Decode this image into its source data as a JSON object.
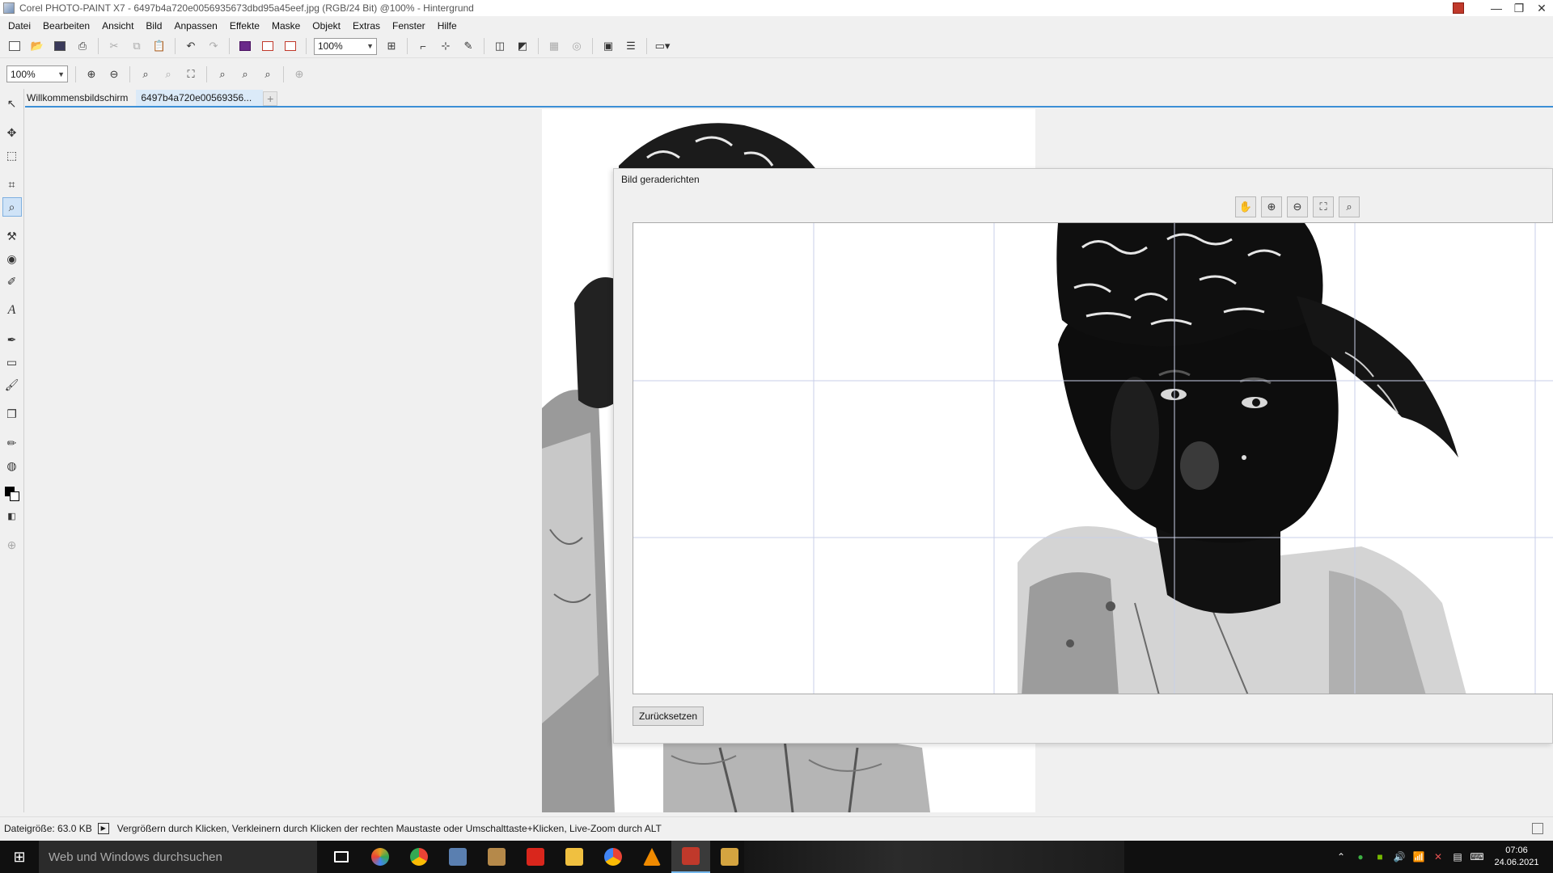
{
  "window": {
    "title": "Corel PHOTO-PAINT X7 - 6497b4a720e0056935673dbd95a45eef.jpg (RGB/24 Bit) @100% - Hintergrund",
    "minimize": "—",
    "maximize": "❐",
    "close": "✕"
  },
  "menu": [
    "Datei",
    "Bearbeiten",
    "Ansicht",
    "Bild",
    "Anpassen",
    "Effekte",
    "Maske",
    "Objekt",
    "Extras",
    "Fenster",
    "Hilfe"
  ],
  "toolbar1": {
    "zoom_value": "100%",
    "icons": [
      "new-file-icon",
      "open-file-icon",
      "save-icon",
      "print-icon",
      "cut-icon",
      "copy-icon",
      "paste-icon",
      "undo-icon",
      "redo-icon",
      "corel-connect-icon",
      "import-icon",
      "export-icon",
      "zoom-level-combo",
      "full-screen-icon",
      "rulers-icon",
      "grid-icon",
      "guidelines-icon",
      "mask-marquee-icon",
      "object-marquee-icon",
      "launch-icon"
    ]
  },
  "toolbar2": {
    "zoom_value": "100%",
    "icons": [
      "zoom-in-icon",
      "zoom-out-icon",
      "zoom-to-selected-icon",
      "zoom-to-all-objects-icon",
      "zoom-to-fit-icon",
      "zoom-100-icon",
      "zoom-width-icon",
      "zoom-height-icon",
      "add-toolbar-icon"
    ]
  },
  "tools": [
    "pick-tool",
    "transform-tool",
    "rectangle-mask-tool",
    "crop-tool",
    "zoom-tool",
    "clone-tool",
    "red-eye-tool",
    "brush-mask-tool",
    "text-tool",
    "effect-tool",
    "rectangle-tool",
    "paint-tool",
    "shadow-tool",
    "eyedropper-tool",
    "fill-tool"
  ],
  "colors": {
    "foreground": "#000000",
    "background": "#ffffff",
    "accent": "#3c8fd6"
  },
  "tabs": [
    {
      "label": "Willkommensbildschirm",
      "active": false
    },
    {
      "label": "6497b4a720e00569356...",
      "active": true
    }
  ],
  "tab_add": "+",
  "dialog": {
    "title": "Bild geraderichten",
    "reset_label": "Zurücksetzen",
    "view_tools": [
      "pan-icon",
      "zoom-in-icon",
      "zoom-out-icon",
      "zoom-to-fit-icon",
      "zoom-100-icon"
    ]
  },
  "status": {
    "file_size": "Dateigröße: 63.0 KB",
    "hint": "Vergrößern durch Klicken, Verkleinern durch Klicken der rechten Maustaste oder Umschalttaste+Klicken, Live-Zoom durch ALT"
  },
  "taskbar": {
    "search_placeholder": "Web und Windows durchsuchen",
    "apps": [
      {
        "name": "task-view-icon",
        "color": "#ffffff"
      },
      {
        "name": "picasa-icon",
        "color": "#e0a020"
      },
      {
        "name": "chrome-icon",
        "color": "#34a853"
      },
      {
        "name": "photo-viewer-icon",
        "color": "#5a7fb0"
      },
      {
        "name": "camera-app-icon",
        "color": "#b5894a"
      },
      {
        "name": "acrobat-icon",
        "color": "#d9261c"
      },
      {
        "name": "file-explorer-icon",
        "color": "#f0c040"
      },
      {
        "name": "chrome-alt-icon",
        "color": "#ea4335"
      },
      {
        "name": "vlc-icon",
        "color": "#f08a00"
      },
      {
        "name": "corel-photo-paint-icon",
        "color": "#c0392b"
      },
      {
        "name": "corel-draw-icon",
        "color": "#d4a440"
      }
    ],
    "clock_time": "07:06",
    "clock_date": "24.06.2021"
  }
}
